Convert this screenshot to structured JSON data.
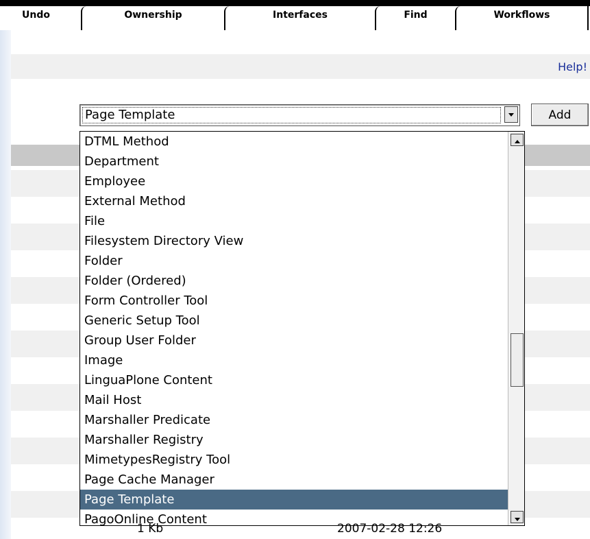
{
  "tabs": [
    {
      "label": "Undo"
    },
    {
      "label": "Ownership"
    },
    {
      "label": "Interfaces"
    },
    {
      "label": "Find"
    },
    {
      "label": "Workflows"
    }
  ],
  "help_link": "Help!",
  "add_form": {
    "selected": "Page Template",
    "add_label": "Add",
    "options": [
      "DTML Method",
      "Department",
      "Employee",
      "External Method",
      "File",
      "Filesystem Directory View",
      "Folder",
      "Folder (Ordered)",
      "Form Controller Tool",
      "Generic Setup Tool",
      "Group User Folder",
      "Image",
      "LinguaPlone Content",
      "Mail Host",
      "Marshaller Predicate",
      "Marshaller Registry",
      "MimetypesRegistry Tool",
      "Page Cache Manager",
      "Page Template",
      "PagoOnline Content"
    ]
  },
  "listing_row": {
    "size": "1 Kb",
    "modified": "2007-02-28 12:26"
  }
}
